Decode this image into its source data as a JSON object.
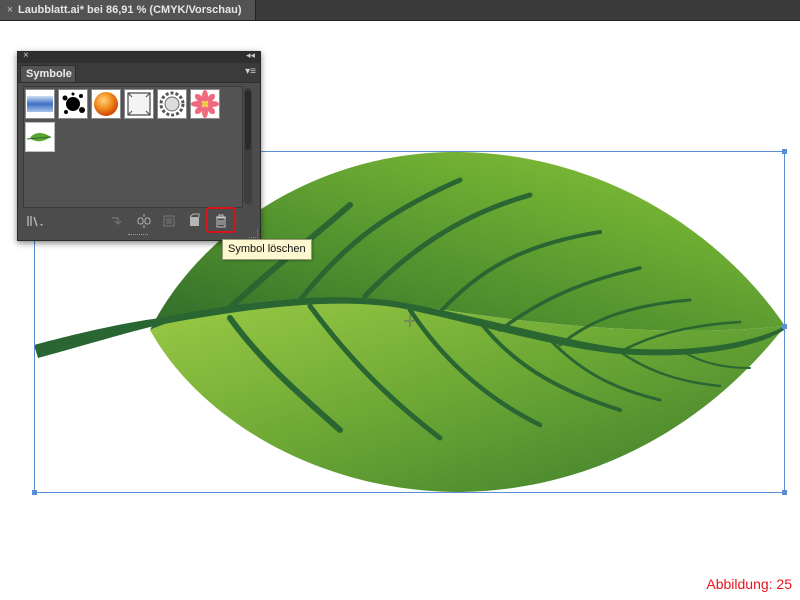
{
  "document_tab": {
    "title": "Laubblatt.ai* bei 86,91 % (CMYK/Vorschau)",
    "close_symbol": "×"
  },
  "panel": {
    "close_symbol": "×",
    "collapse_symbol": "◂◂",
    "tab_label": "Symbole",
    "menu_symbol": "▾≡",
    "symbols": [
      {
        "name": "blue-bar-symbol"
      },
      {
        "name": "ink-splat-symbol"
      },
      {
        "name": "orange-sphere-symbol"
      },
      {
        "name": "frame-symbol"
      },
      {
        "name": "badge-symbol"
      },
      {
        "name": "flower-symbol"
      },
      {
        "name": "leaf-symbol"
      }
    ],
    "footer_icons": [
      "library-menu-icon",
      "place-symbol-instance-icon",
      "break-link-icon",
      "symbol-options-icon",
      "new-symbol-icon",
      "trash-icon"
    ],
    "tooltip": "Symbol löschen"
  },
  "caption": "Abbildung: 25",
  "colors": {
    "leaf_light": "#8cc13a",
    "leaf_dark": "#2f6b2a",
    "vein": "#2a6632",
    "selection": "#5a8fd6",
    "highlight": "#d6141c"
  }
}
